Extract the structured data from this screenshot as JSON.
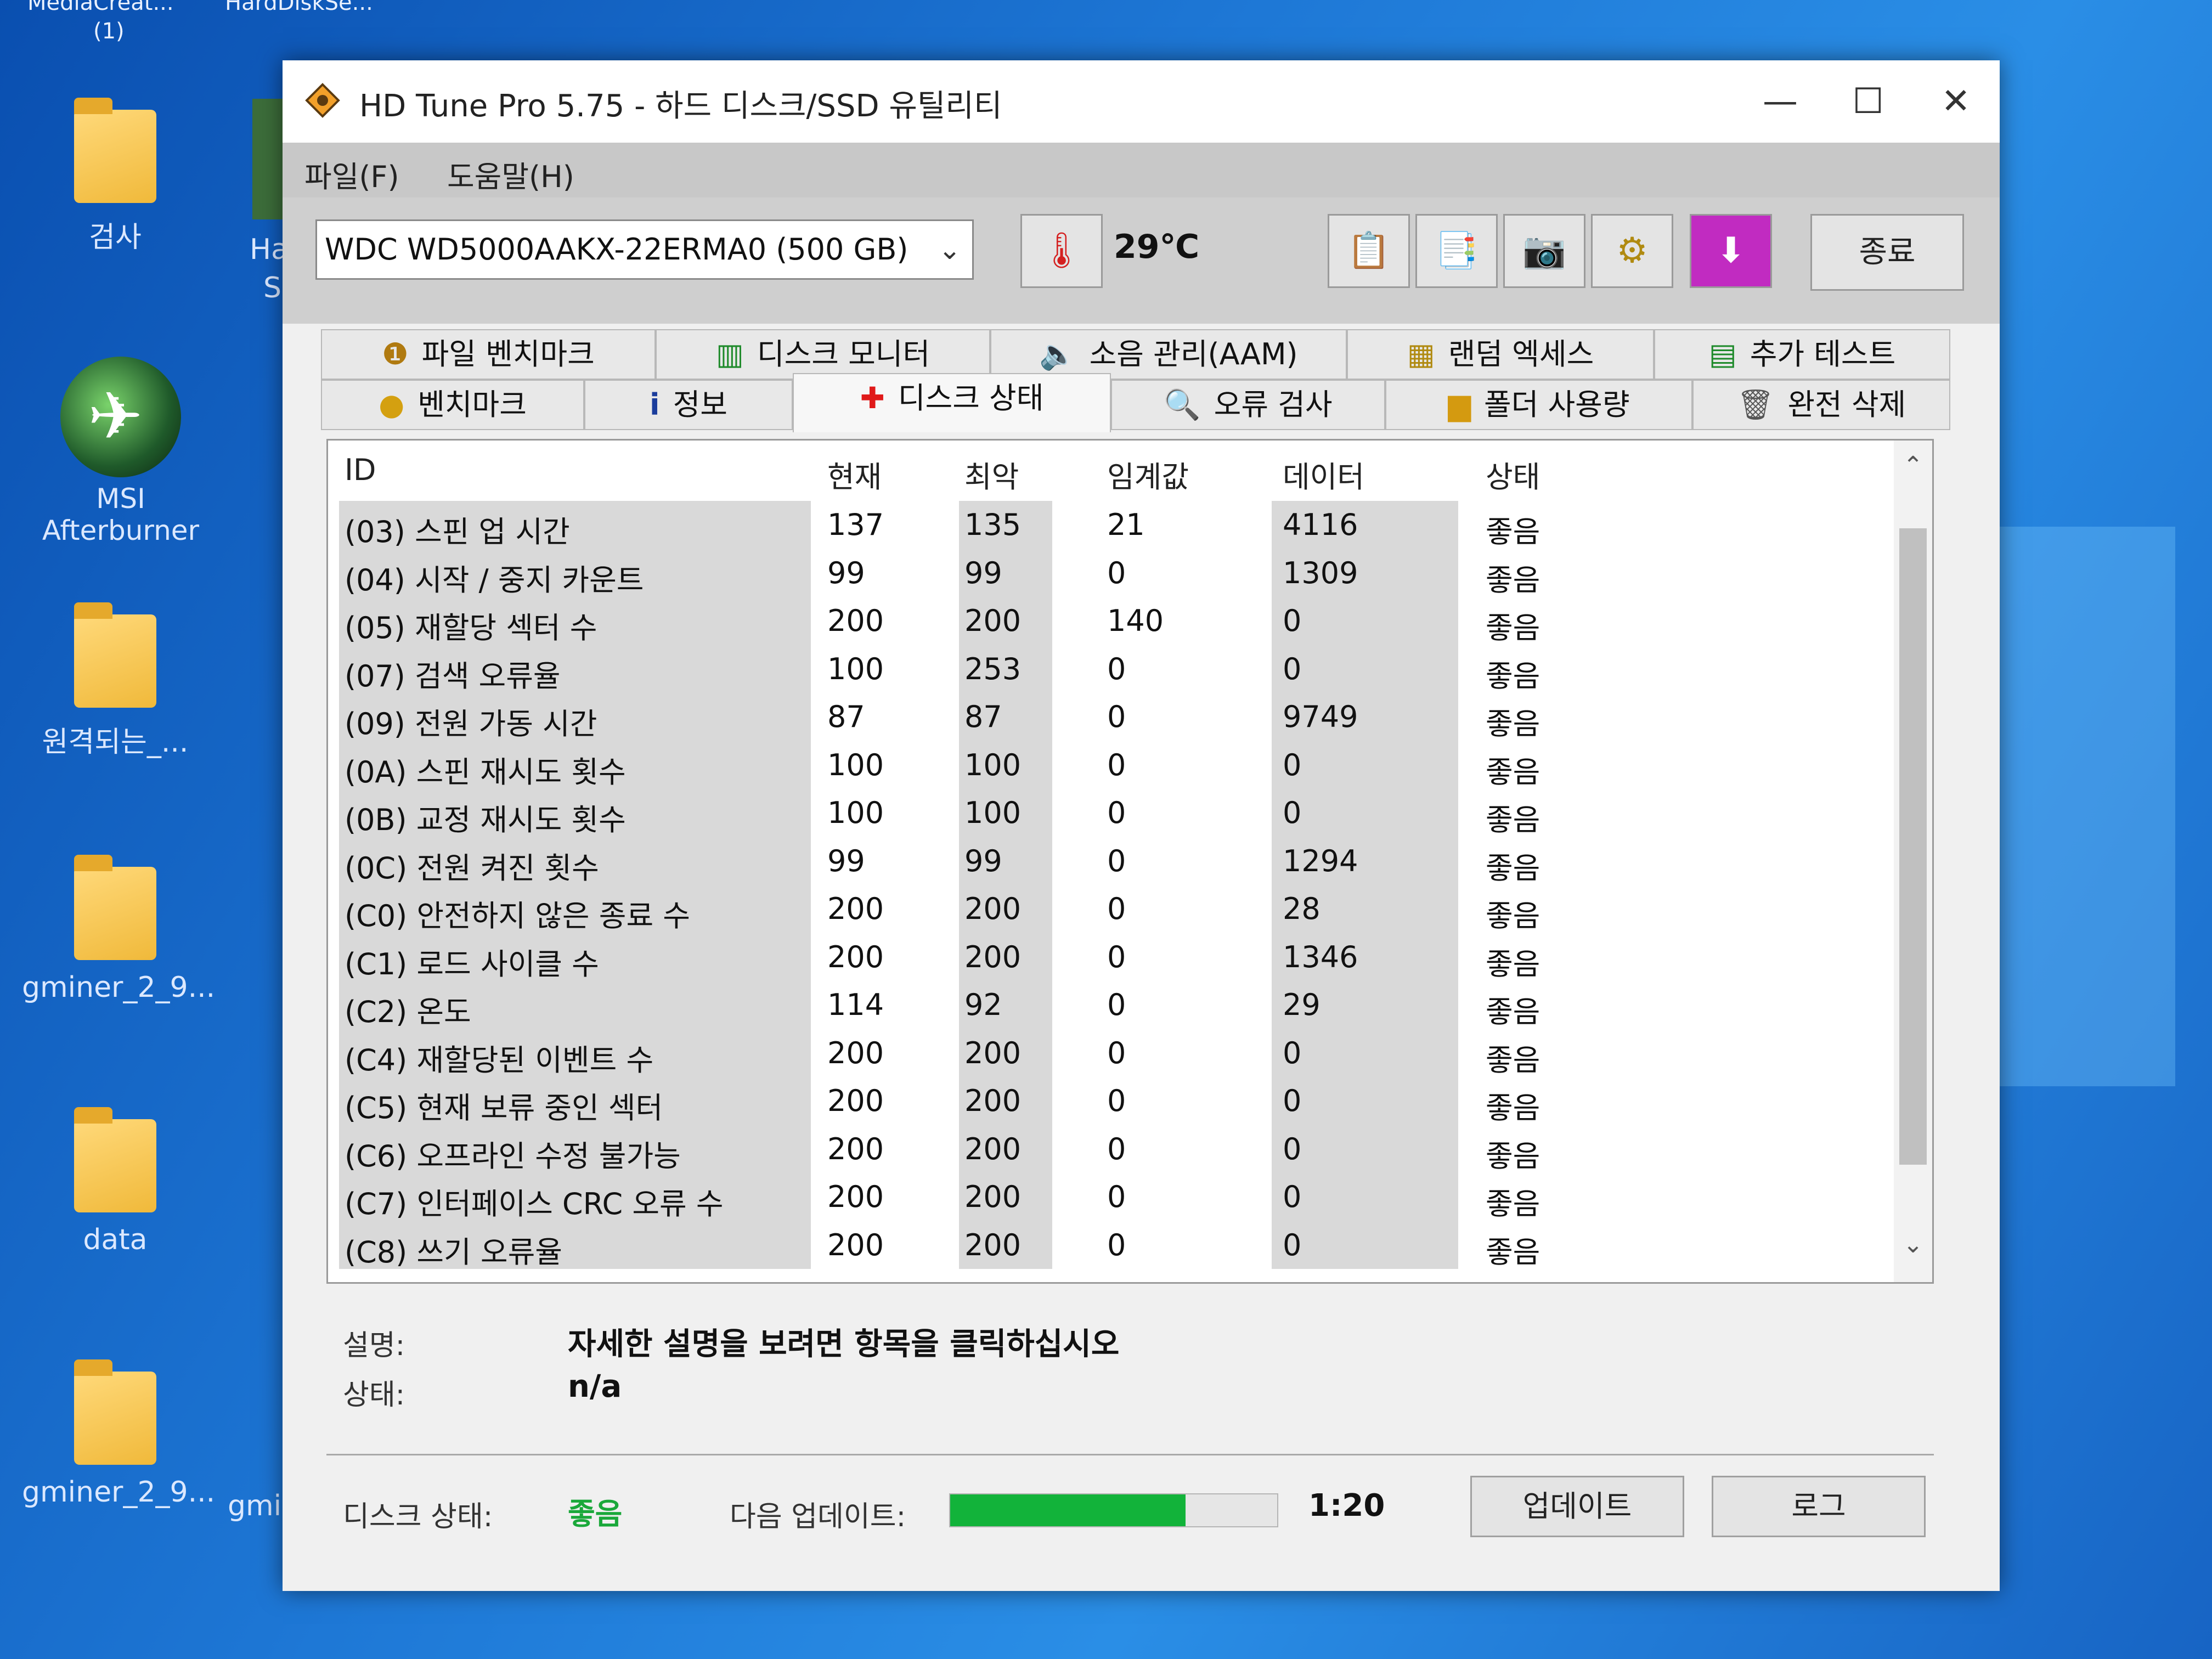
{
  "desktop": {
    "top_labels": [
      "MediaCreat...",
      "HardDiskSe..."
    ],
    "top_sub": "(1)",
    "icons": [
      {
        "label": "검사"
      },
      {
        "label": "MSI Afterburner"
      },
      {
        "label": "원격되는_..."
      },
      {
        "label": "gminer_2_9..."
      },
      {
        "label": "data"
      },
      {
        "label": "gminer_2_9..."
      }
    ],
    "partial_labels": [
      "Ha",
      "S",
      "gmi"
    ]
  },
  "window": {
    "title": "HD Tune Pro 5.75 - 하드 디스크/SSD 유틸리티",
    "controls": {
      "minimize": "—",
      "maximize": "☐",
      "close": "✕"
    }
  },
  "menu": {
    "file": "파일(F)",
    "help": "도움말(H)"
  },
  "toolbar": {
    "drive": "WDC WD5000AAKX-22ERMA0 (500 GB)",
    "temperature": "29℃",
    "exit_label": "종료"
  },
  "tabs_row1": [
    "파일 벤치마크",
    "디스크 모니터",
    "소음 관리(AAM)",
    "랜덤 엑세스",
    "추가 테스트"
  ],
  "tabs_row2": [
    "벤치마크",
    "정보",
    "디스크 상태",
    "오류 검사",
    "폴더 사용량",
    "완전 삭제"
  ],
  "active_tab": "디스크 상태",
  "table": {
    "headers": [
      "ID",
      "현재",
      "최악",
      "임계값",
      "데이터",
      "상태"
    ],
    "rows": [
      [
        "(03) 스핀 업 시간",
        "137",
        "135",
        "21",
        "4116",
        "좋음"
      ],
      [
        "(04) 시작 / 중지 카운트",
        "99",
        "99",
        "0",
        "1309",
        "좋음"
      ],
      [
        "(05) 재할당 섹터 수",
        "200",
        "200",
        "140",
        "0",
        "좋음"
      ],
      [
        "(07) 검색 오류율",
        "100",
        "253",
        "0",
        "0",
        "좋음"
      ],
      [
        "(09) 전원 가동 시간",
        "87",
        "87",
        "0",
        "9749",
        "좋음"
      ],
      [
        "(0A) 스핀 재시도 횟수",
        "100",
        "100",
        "0",
        "0",
        "좋음"
      ],
      [
        "(0B) 교정 재시도 횟수",
        "100",
        "100",
        "0",
        "0",
        "좋음"
      ],
      [
        "(0C) 전원 켜진 횟수",
        "99",
        "99",
        "0",
        "1294",
        "좋음"
      ],
      [
        "(C0) 안전하지 않은 종료 수",
        "200",
        "200",
        "0",
        "28",
        "좋음"
      ],
      [
        "(C1) 로드 사이클 수",
        "200",
        "200",
        "0",
        "1346",
        "좋음"
      ],
      [
        "(C2) 온도",
        "114",
        "92",
        "0",
        "29",
        "좋음"
      ],
      [
        "(C4) 재할당된 이벤트 수",
        "200",
        "200",
        "0",
        "0",
        "좋음"
      ],
      [
        "(C5) 현재 보류 중인 섹터",
        "200",
        "200",
        "0",
        "0",
        "좋음"
      ],
      [
        "(C6) 오프라인 수정 불가능",
        "200",
        "200",
        "0",
        "0",
        "좋음"
      ],
      [
        "(C7) 인터페이스 CRC 오류 수",
        "200",
        "200",
        "0",
        "0",
        "좋음"
      ],
      [
        "(C8) 쓰기 오류율",
        "200",
        "200",
        "0",
        "0",
        "좋음"
      ]
    ]
  },
  "details": {
    "desc_label": "설명:",
    "desc_value": "자세한 설명을 보려면 항목을 클릭하십시오",
    "status_label": "상태:",
    "status_value": "n/a"
  },
  "footer": {
    "disk_status_label": "디스크 상태:",
    "disk_status_value": "좋음",
    "next_update_label": "다음 업데이트:",
    "progress_fraction": 0.72,
    "time": "1:20",
    "update_button": "업데이트",
    "log_button": "로그"
  },
  "colors": {
    "good": "#1aa83a",
    "progress": "#12b33a"
  }
}
